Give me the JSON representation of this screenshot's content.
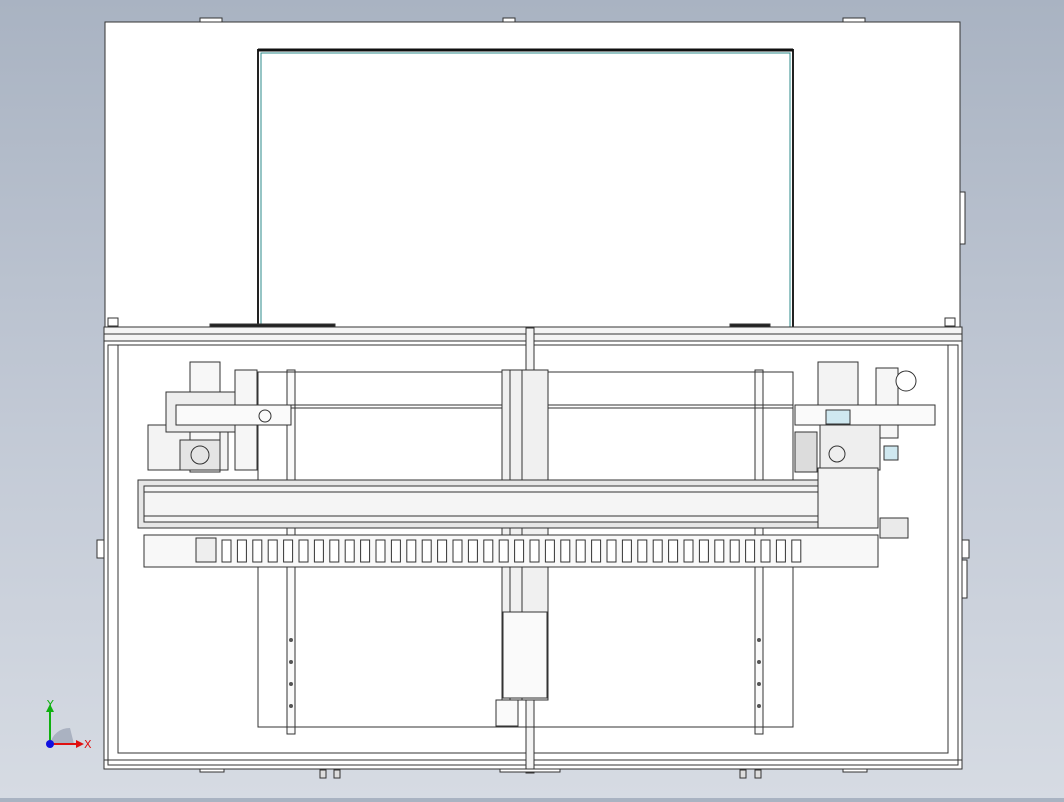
{
  "viewport": {
    "background_top": "#a9b3c2",
    "background_bottom": "#d6dbe3",
    "line_color": "#3a3a3a",
    "panel_fill": "#ffffff",
    "frame_fill": "#f2f2f2",
    "accent_teal": "#2e8b8b"
  },
  "triad": {
    "x_label": "X",
    "y_label": "Y",
    "x_color": "#e01010",
    "y_color": "#10b010",
    "z_color": "#1010e0"
  }
}
